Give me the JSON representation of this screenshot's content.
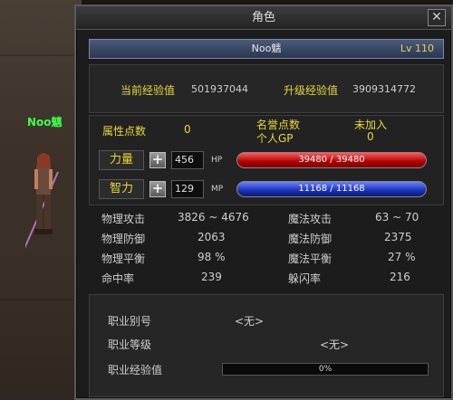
{
  "world": {
    "player_name": "Noo魑"
  },
  "window": {
    "title": "角色",
    "close_glyph": "✕"
  },
  "header": {
    "name": "Noo魑",
    "level": "Lv 110"
  },
  "exp": {
    "current_label": "当前经验值",
    "current_value": "501937044",
    "upgrade_label": "升级经验值",
    "upgrade_value": "3909314772"
  },
  "points": {
    "attr_label": "属性点数",
    "attr_value": "0",
    "honor_label": "名誉点数",
    "honor_value": "未加入",
    "gp_label": "个人GP",
    "gp_value": "0"
  },
  "attributes": [
    {
      "label": "力量",
      "value": "456",
      "bar_tag": "HP",
      "bar_text": "39480 / 39480",
      "fill": 1.0,
      "color": "#c00000"
    },
    {
      "label": "智力",
      "value": "129",
      "bar_tag": "MP",
      "bar_text": "11168 / 11168",
      "fill": 1.0,
      "color": "#1a30c0"
    }
  ],
  "stats": {
    "left": [
      {
        "label": "物理攻击",
        "value": "3826 ~ 4676"
      },
      {
        "label": "物理防御",
        "value": "2063"
      },
      {
        "label": "物理平衡",
        "value": "98 %"
      },
      {
        "label": "命中率",
        "value": "239"
      }
    ],
    "right": [
      {
        "label": "魔法攻击",
        "value": "63 ~ 70"
      },
      {
        "label": "魔法防御",
        "value": "2375"
      },
      {
        "label": "魔法平衡",
        "value": "27 %"
      },
      {
        "label": "躲闪率",
        "value": "216"
      }
    ]
  },
  "job": {
    "alias_label": "职业别号",
    "alias_value": "<无>",
    "level_label": "职业等级",
    "level_value": "<无>",
    "exp_label": "职业经验值",
    "exp_value": "0%",
    "exp_fill": 0.0
  },
  "colors": {
    "accent_yellow": "#e8d83a",
    "name_green": "#3cff4a"
  }
}
